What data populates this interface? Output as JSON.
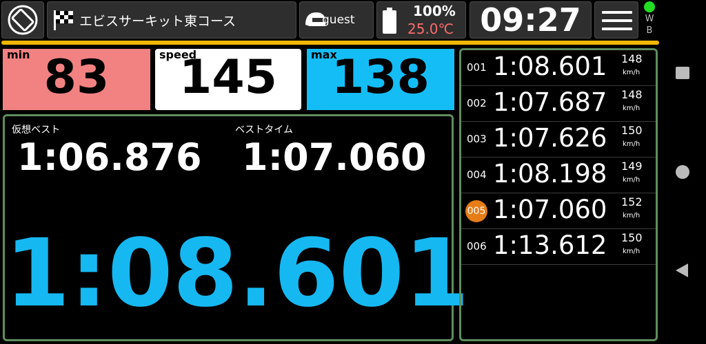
{
  "topbar": {
    "course_name": "エビスサーキット東コース",
    "user_name": "guest",
    "battery_percent": "100%",
    "temperature": "25.0℃",
    "clock": "09:27",
    "wb_w": "W",
    "wb_b": "B"
  },
  "stats": {
    "min_label": "min",
    "min_value": "83",
    "speed_label": "speed",
    "speed_value": "145",
    "max_label": "max",
    "max_value": "138"
  },
  "best": {
    "virtual_best_label": "仮想ベスト",
    "virtual_best_time": "1:06.876",
    "best_time_label": "ベストタイム",
    "best_time": "1:07.060",
    "current_lap_time": "1:08.601"
  },
  "laps": [
    {
      "num": "001",
      "time": "1:08.601",
      "speed": "148",
      "unit": "km/h",
      "best": false
    },
    {
      "num": "002",
      "time": "1:07.687",
      "speed": "148",
      "unit": "km/h",
      "best": false
    },
    {
      "num": "003",
      "time": "1:07.626",
      "speed": "150",
      "unit": "km/h",
      "best": false
    },
    {
      "num": "004",
      "time": "1:08.198",
      "speed": "149",
      "unit": "km/h",
      "best": false
    },
    {
      "num": "005",
      "time": "1:07.060",
      "speed": "152",
      "unit": "km/h",
      "best": true
    },
    {
      "num": "006",
      "time": "1:13.612",
      "speed": "150",
      "unit": "km/h",
      "best": false
    }
  ],
  "colors": {
    "min_bg": "#f28282",
    "max_bg": "#15bdf6",
    "speed_bg": "#ffffff",
    "accent_line": "#f2b600",
    "current_time": "#16b8f2",
    "best_lap_marker": "#e67d17",
    "temperature": "#ff6b6b",
    "led": "#22dd22"
  },
  "icons": [
    "rotate-screen-icon",
    "checkered-flag-icon",
    "helmet-icon",
    "battery-icon",
    "menu-icon",
    "square-nav-icon",
    "circle-nav-icon",
    "triangle-nav-icon"
  ]
}
